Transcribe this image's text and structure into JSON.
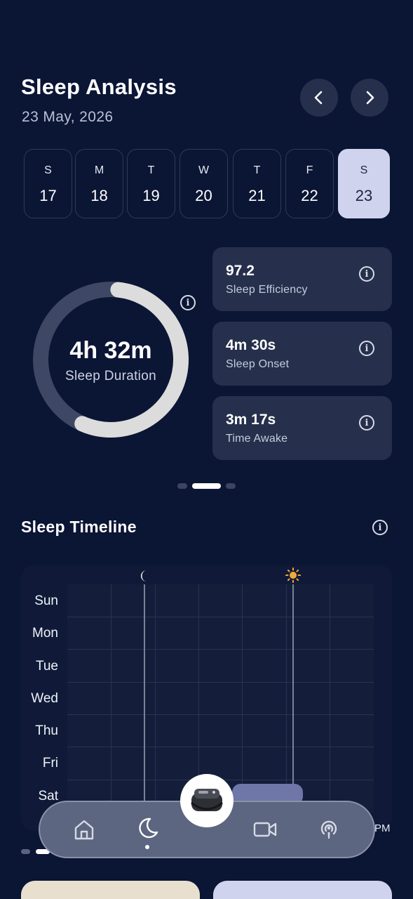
{
  "header": {
    "title": "Sleep Analysis",
    "date": "23 May, 2026",
    "prev_icon": "chevron-left-icon",
    "next_icon": "chevron-right-icon"
  },
  "days": [
    {
      "letter": "S",
      "num": "17",
      "selected": false
    },
    {
      "letter": "M",
      "num": "18",
      "selected": false
    },
    {
      "letter": "T",
      "num": "19",
      "selected": false
    },
    {
      "letter": "W",
      "num": "20",
      "selected": false
    },
    {
      "letter": "T",
      "num": "21",
      "selected": false
    },
    {
      "letter": "F",
      "num": "22",
      "selected": false
    },
    {
      "letter": "S",
      "num": "23",
      "selected": true
    }
  ],
  "summary": {
    "duration_value": "4h 32m",
    "duration_label": "Sleep Duration",
    "ring_fraction": 0.55,
    "cards": [
      {
        "value": "97.2",
        "label": "Sleep Efficiency"
      },
      {
        "value": "4m 30s",
        "label": "Sleep Onset"
      },
      {
        "value": "3m 17s",
        "label": "Time Awake"
      }
    ],
    "pager_active_index": 1
  },
  "timeline": {
    "title": "Sleep Timeline",
    "rows": [
      "Sun",
      "Mon",
      "Tue",
      "Wed",
      "Thu",
      "Fri",
      "Sat"
    ],
    "start_icon": "moon-icon",
    "end_icon": "sun-icon",
    "time_fragment": "PM"
  },
  "nav": {
    "items": [
      "home-icon",
      "moon-icon",
      "device-icon",
      "video-icon",
      "podcast-icon"
    ],
    "active": "moon-icon"
  },
  "colors": {
    "background": "#0b1534",
    "card": "#26304c",
    "selected_day": "#cfd3ee",
    "ring_track": "#3e4865",
    "ring_fill": "#dcdcdc",
    "sleep_bar": "#6f77a8",
    "sun": "#f2a93b",
    "bottom_card_left": "#e8dfcf",
    "bottom_card_right": "#cfd3ee"
  }
}
